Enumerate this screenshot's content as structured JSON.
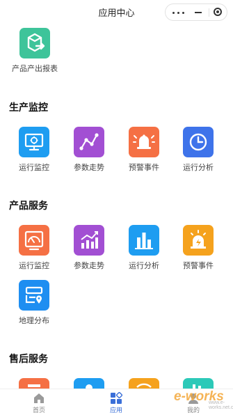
{
  "header": {
    "title": "应用中心"
  },
  "top_apps": [
    {
      "label": "产品产出报表",
      "icon": "export-report-icon",
      "color": "#3ec49a"
    }
  ],
  "sections": [
    {
      "title": "生产监控",
      "items": [
        {
          "label": "运行监控",
          "icon": "monitor-screen-icon",
          "color": "#1e9df1"
        },
        {
          "label": "参数走势",
          "icon": "trend-line-icon",
          "color": "#a24fd3"
        },
        {
          "label": "预警事件",
          "icon": "alarm-bell-icon",
          "color": "#f57044"
        },
        {
          "label": "运行分析",
          "icon": "clock-icon",
          "color": "#3e73ea"
        }
      ]
    },
    {
      "title": "产品服务",
      "items": [
        {
          "label": "运行监控",
          "icon": "gauge-icon",
          "color": "#f57044"
        },
        {
          "label": "参数走势",
          "icon": "bar-trend-icon",
          "color": "#a24fd3"
        },
        {
          "label": "运行分析",
          "icon": "bar-chart-icon",
          "color": "#1e9df1"
        },
        {
          "label": "预警事件",
          "icon": "warning-light-icon",
          "color": "#f5a21d"
        },
        {
          "label": "地理分布",
          "icon": "map-location-icon",
          "color": "#1e8ef1"
        }
      ]
    },
    {
      "title": "售后服务",
      "items": [
        {
          "label": "",
          "icon": "partial-icon",
          "color": "#f57044"
        },
        {
          "label": "",
          "icon": "partial-icon",
          "color": "#1e9df1"
        },
        {
          "label": "",
          "icon": "partial-icon",
          "color": "#f5a21d"
        },
        {
          "label": "",
          "icon": "partial-icon",
          "color": "#2cc9b8"
        }
      ]
    }
  ],
  "tabbar": [
    {
      "label": "首页",
      "icon": "home-icon",
      "active": false
    },
    {
      "label": "应用",
      "icon": "apps-icon",
      "active": true
    },
    {
      "label": "我的",
      "icon": "user-icon",
      "active": false
    }
  ],
  "watermark": {
    "text": "e-works",
    "sub": "www.e-works.net.cn"
  }
}
